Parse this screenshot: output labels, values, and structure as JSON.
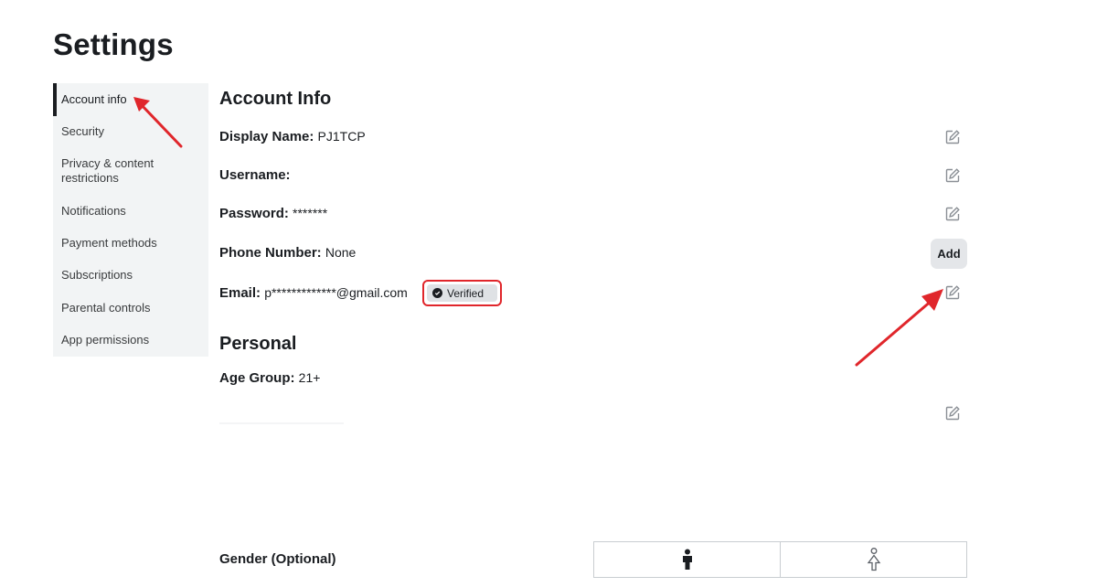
{
  "page": {
    "title": "Settings"
  },
  "sidebar": {
    "items": [
      {
        "label": "Account info",
        "active": true
      },
      {
        "label": "Security"
      },
      {
        "label": "Privacy & content restrictions"
      },
      {
        "label": "Notifications"
      },
      {
        "label": "Payment methods"
      },
      {
        "label": "Subscriptions"
      },
      {
        "label": "Parental controls"
      },
      {
        "label": "App permissions"
      }
    ]
  },
  "account_info": {
    "heading": "Account Info",
    "display_name": {
      "label": "Display Name:",
      "value": "PJ1TCP"
    },
    "username": {
      "label": "Username:",
      "value": ""
    },
    "password": {
      "label": "Password:",
      "value": "*******"
    },
    "phone": {
      "label": "Phone Number:",
      "value": "None",
      "add_label": "Add"
    },
    "email": {
      "label": "Email:",
      "value": "p*************@gmail.com",
      "badge": "Verified"
    }
  },
  "personal": {
    "heading": "Personal",
    "age_group": {
      "label": "Age Group:",
      "value": "21+"
    },
    "gender": {
      "label": "Gender (Optional)",
      "options": [
        "male-icon",
        "female-icon"
      ]
    }
  },
  "colors": {
    "annotation_red": "#e0262b",
    "sidebar_bg": "#f2f4f5",
    "badge_bg": "#dfe2e5",
    "add_button_bg": "#e4e6e9"
  },
  "icons": {
    "edit": "edit-icon",
    "verified": "check-circle-icon"
  }
}
